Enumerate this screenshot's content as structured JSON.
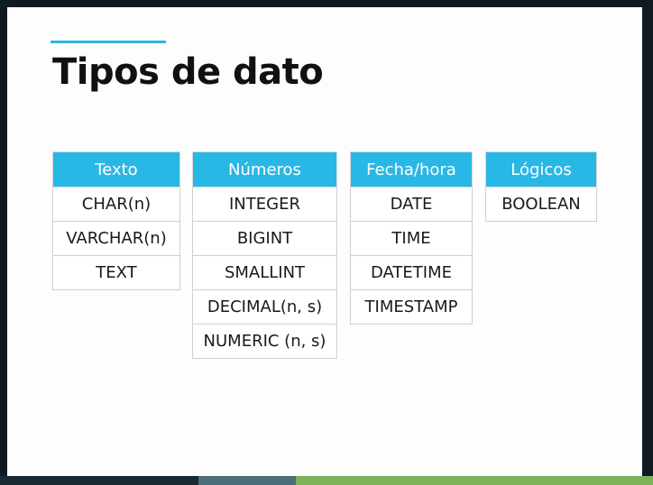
{
  "slide": {
    "title": "Tipos de dato"
  },
  "tables": [
    {
      "header": "Texto",
      "rows": [
        "CHAR(n)",
        "VARCHAR(n)",
        "TEXT"
      ]
    },
    {
      "header": "Números",
      "rows": [
        "INTEGER",
        "BIGINT",
        "SMALLINT",
        "DECIMAL(n, s)",
        "NUMERIC (n, s)"
      ]
    },
    {
      "header": "Fecha/hora",
      "rows": [
        "DATE",
        "TIME",
        "DATETIME",
        "TIMESTAMP"
      ]
    },
    {
      "header": "Lógicos",
      "rows": [
        "BOOLEAN"
      ]
    }
  ],
  "colors": {
    "accent": "#2bb7e3",
    "header_fill": "#29b7e6",
    "header_text": "#ffffff",
    "title_text": "#111111"
  }
}
